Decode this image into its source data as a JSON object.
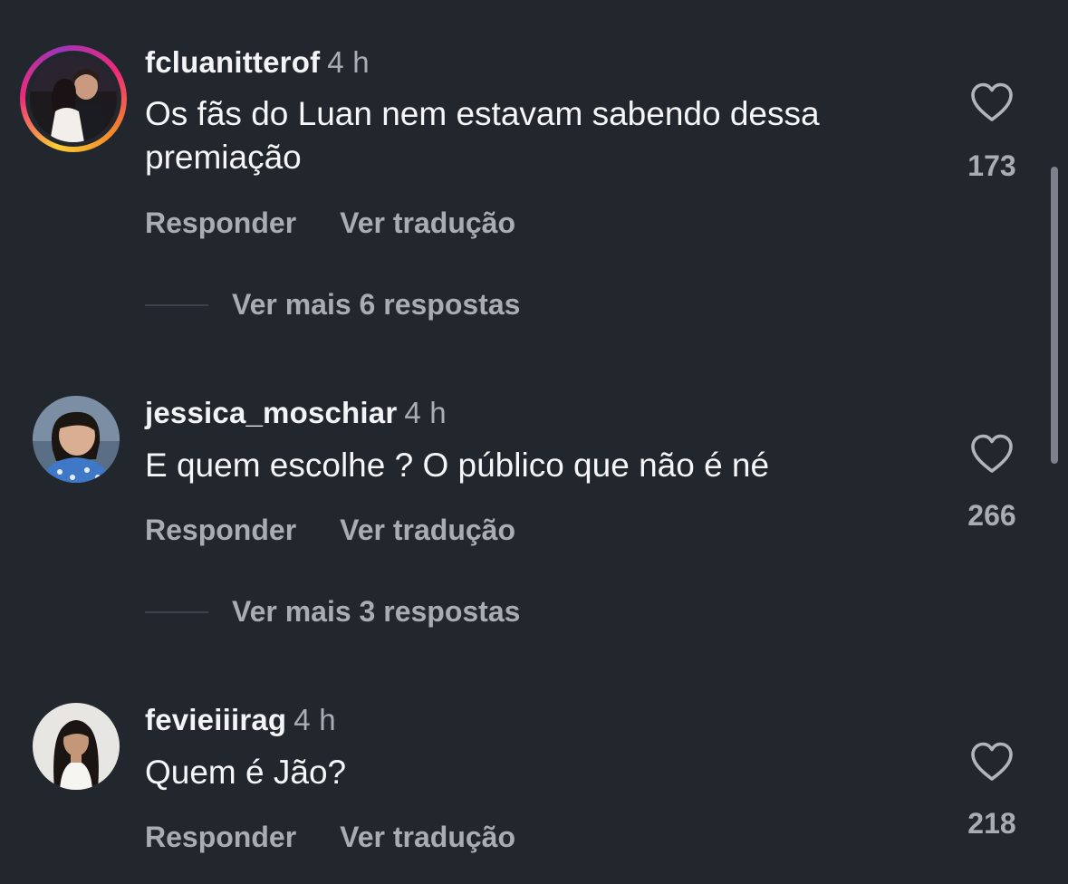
{
  "comments": [
    {
      "username": "fcluanitterof",
      "time": "4 h",
      "text": "Os fãs do Luan nem estavam sabendo dessa premiação",
      "likes": "173",
      "reply_label": "Responder",
      "translate_label": "Ver tradução",
      "more_replies": "Ver mais 6 respostas",
      "has_story": true
    },
    {
      "username": "jessica_moschiar",
      "time": "4 h",
      "text": "E quem escolhe ? O público que não é né",
      "likes": "266",
      "reply_label": "Responder",
      "translate_label": "Ver tradução",
      "more_replies": "Ver mais 3 respostas",
      "has_story": false
    },
    {
      "username": "fevieiiirag",
      "time": "4 h",
      "text": "Quem é Jão?",
      "likes": "218",
      "reply_label": "Responder",
      "translate_label": "Ver tradução",
      "has_story": false
    }
  ],
  "icons": {
    "like": "heart-outline-icon"
  },
  "colors": {
    "background": "#22262d",
    "secondary_text": "#a9adb3",
    "primary_text": "#f5f6f8"
  }
}
